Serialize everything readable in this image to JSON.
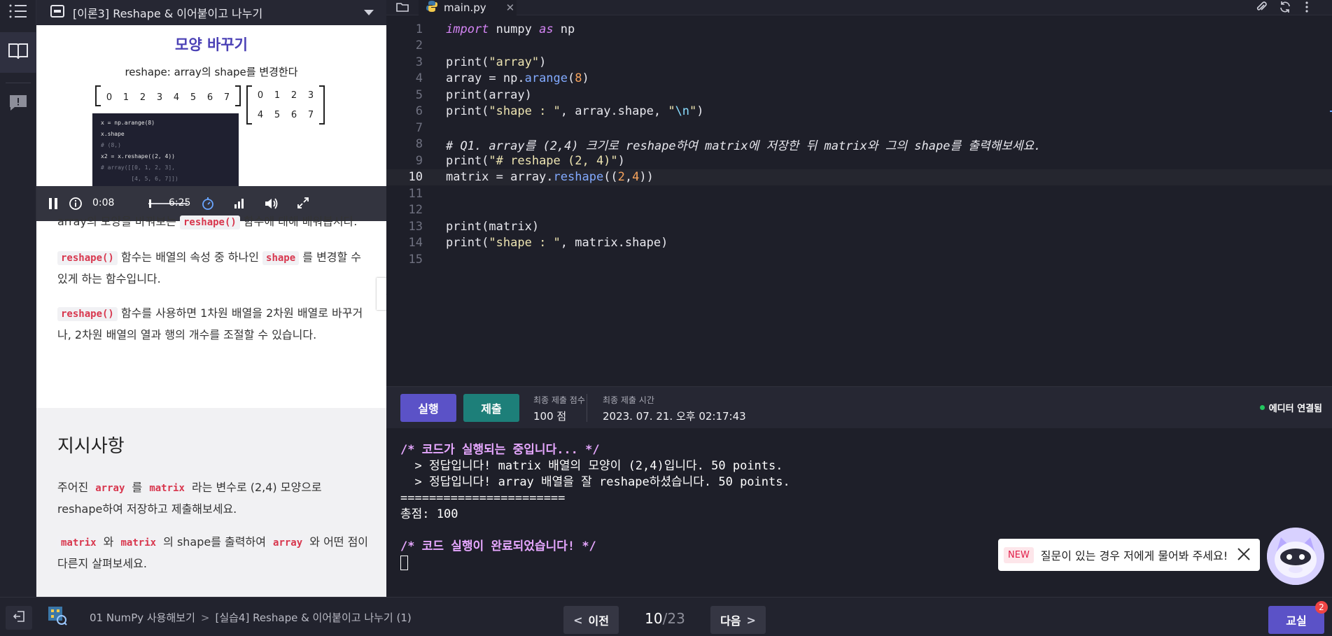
{
  "lesson": {
    "title": "[이론3] Reshape & 이어붙이고 나누기",
    "slide": {
      "title": "모양 바꾸기",
      "subtitle": "reshape: array의 shape를 변경한다",
      "row": [
        "0",
        "1",
        "2",
        "3",
        "4",
        "5",
        "6",
        "7"
      ],
      "matrix": [
        "0",
        "1",
        "2",
        "3",
        "4",
        "5",
        "6",
        "7"
      ],
      "code": [
        "x = np.arange(8)",
        "x.shape",
        "# (8,)",
        "x2 = x.reshape((2, 4))",
        "# array([[0, 1, 2, 3],",
        "         [4, 5, 6, 7]])"
      ]
    },
    "video": {
      "current": "0:08",
      "duration": "6:25",
      "progress": 0.02
    },
    "intro": {
      "pre": "array의 모양을 바꿔보는 ",
      "tag": "reshape()",
      "post": " 함수에 대해 배워봅시다."
    },
    "p2": {
      "tag1": "reshape()",
      "mid": " 함수는 배열의 속성 중 하나인 ",
      "tag2": "shape",
      "post": " 를 변경할 수 있게 하는 함수입니다."
    },
    "p3": {
      "tag": "reshape()",
      "post": " 함수를 사용하면 1차원 배열을 2차원 배열로 바꾸거나, 2차원 배열의 열과 행의 개수를 조절할 수 있습니다."
    },
    "directions": {
      "heading": "지시사항",
      "d1": {
        "pre": "주어진 ",
        "tag1": "array",
        "mid1": " 를 ",
        "tag2": "matrix",
        "post": " 라는 변수로 (2,4) 모양으로 reshape하여 저장하고 제출해보세요."
      },
      "d2": {
        "tag1": "matrix",
        "mid1": " 와 ",
        "tag2": "matrix",
        "mid2": " 의 shape를 출력하여 ",
        "tag3": "array",
        "post": " 와 어떤 점이 다른지 살펴보세요."
      }
    }
  },
  "editor": {
    "tab_name": "main.py",
    "current_line": 10,
    "lines": [
      "1",
      "2",
      "3",
      "4",
      "5",
      "6",
      "7",
      "8",
      "9",
      "10",
      "11",
      "12",
      "13",
      "14",
      "15"
    ]
  },
  "toolbar": {
    "run_label": "실행",
    "submit_label": "제출",
    "score_label": "최종 제출 점수",
    "score_value": "100 점",
    "time_label": "최종 제출 시간",
    "time_value": "2023. 07. 21. 오후 02:17:43",
    "connection": "에디터 연결됨"
  },
  "console": [
    "/* 코드가 실행되는 중입니다... */",
    "  > 정답입니다! matrix 배열의 모양이 (2,4)입니다. 50 points.",
    "  > 정답입니다! array 배열을 잘 reshape하셨습니다. 50 points.",
    "=======================",
    "총점: 100",
    "",
    "/* 코드 실행이 완료되었습니다! */"
  ],
  "chat": {
    "new_badge": "NEW",
    "message": "질문이 있는 경우 저에게 물어봐 주세요!"
  },
  "footer": {
    "crumb1": "01 NumPy 사용해보기",
    "crumb2": "[실습4] Reshape & 이어붙이고 나누기 (1)",
    "prev_label": "이전",
    "next_label": "다음",
    "page_current": "10",
    "page_total": "/23",
    "class_label": "교실",
    "class_badge": "2"
  },
  "colors": {
    "accent": "#5b52c7",
    "submit": "#1d7f79",
    "editor_bg": "#1e1f29",
    "connected": "#22c55e"
  }
}
